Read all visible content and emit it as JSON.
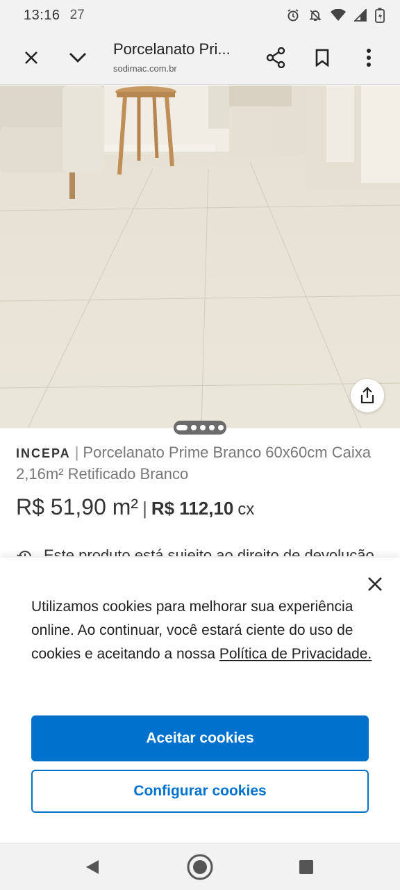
{
  "status_bar": {
    "time": "13:16",
    "temperature": "27",
    "icons": [
      "alarm-icon",
      "mute-icon",
      "wifi-icon",
      "signal-icon",
      "battery-icon"
    ]
  },
  "toolbar": {
    "title": "Porcelanato Pri...",
    "url": "sodimac.com.br",
    "icons": [
      "close-icon",
      "chevron-down-icon",
      "share-icon",
      "bookmark-icon",
      "more-vert-icon"
    ]
  },
  "gallery": {
    "dots_count": 5,
    "active_dot": 0
  },
  "product": {
    "brand": "INCEPA",
    "separator": "|",
    "name": "Porcelanato Prime Branco 60x60cm Caixa 2,16m² Retificado Branco",
    "price_per_m2": "R$ 51,90 m²",
    "price_separator": "|",
    "price_box": "R$ 112,10",
    "price_box_unit": "cx",
    "return_notice": "Este produto está sujeito ao direito de devolução"
  },
  "cookie_banner": {
    "text_before_link": "Utilizamos cookies para melhorar sua experiência online. Ao continuar, você estará ciente do uso de cookies e aceitando a nossa ",
    "link_text": "Política de Privacidade.",
    "accept_label": "Aceitar cookies",
    "configure_label": "Configurar cookies"
  },
  "colors": {
    "accent": "#0072ce",
    "chrome_bg": "#f2f2f2"
  }
}
